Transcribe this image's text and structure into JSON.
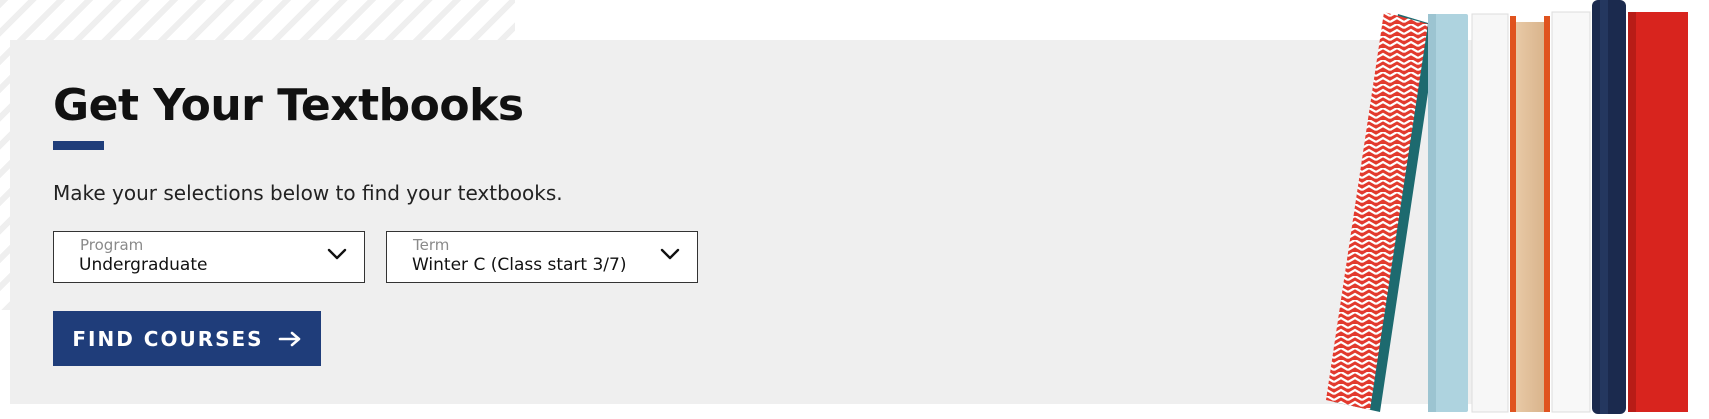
{
  "hero": {
    "title": "Get Your Textbooks",
    "subtitle": "Make your selections below to find your textbooks."
  },
  "program_select": {
    "label": "Program",
    "value": "Undergraduate"
  },
  "term_select": {
    "label": "Term",
    "value": "Winter C (Class start 3/7)"
  },
  "find_button": {
    "label": "FIND COURSES",
    "icon": "arrow-right-icon"
  },
  "colors": {
    "accent": "#1f3d7a",
    "panel_bg": "#efefef",
    "book_red": "#d8241e",
    "book_navy": "#1b2a4e",
    "book_lightblue": "#aed3df"
  }
}
